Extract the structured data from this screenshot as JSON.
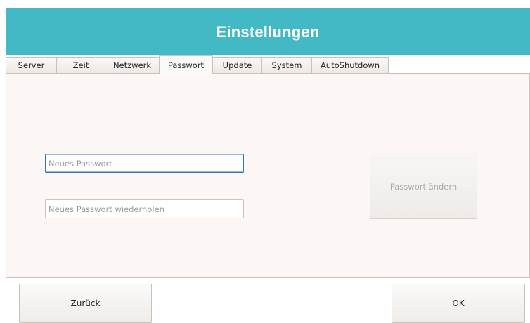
{
  "window": {
    "title": "Einstellungen"
  },
  "tabs": [
    {
      "label": "Server"
    },
    {
      "label": "Zeit"
    },
    {
      "label": "Netzwerk"
    },
    {
      "label": "Passwort",
      "active": true
    },
    {
      "label": "Update"
    },
    {
      "label": "System"
    },
    {
      "label": "AutoShutdown"
    }
  ],
  "password_panel": {
    "new_password": {
      "value": "",
      "placeholder": "Neues Passwort"
    },
    "repeat_password": {
      "value": "",
      "placeholder": "Neues Passwort wiederholen"
    },
    "change_button_label": "Passwort ändern"
  },
  "footer": {
    "back_label": "Zurück",
    "ok_label": "OK"
  },
  "colors": {
    "title_bar": "#44b9c6",
    "panel_background": "#fcf7f4",
    "focus_border": "#2f74b3"
  }
}
